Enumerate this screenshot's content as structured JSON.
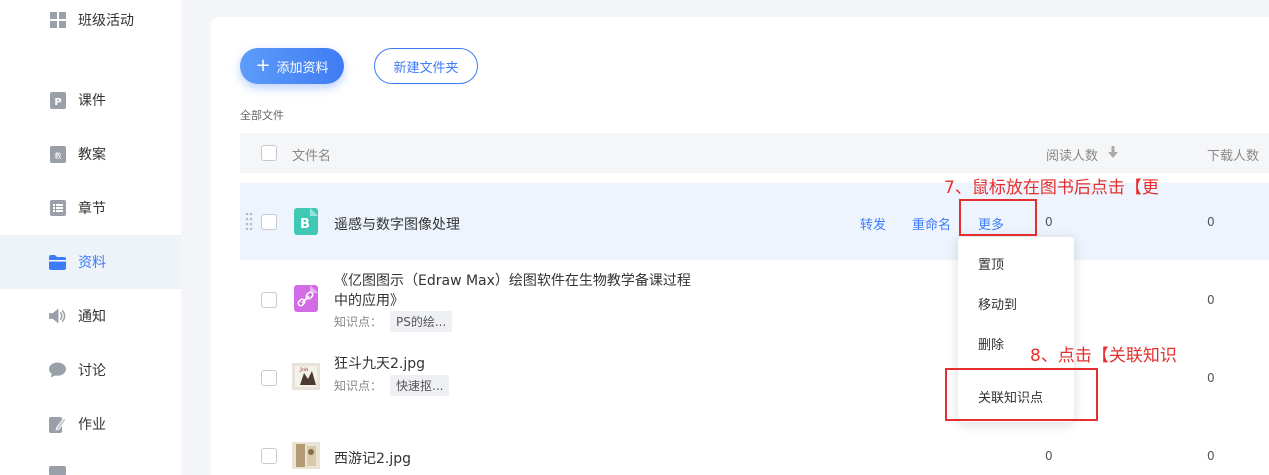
{
  "sidebar": {
    "items": [
      {
        "label": "班级活动",
        "icon": "grid-icon"
      },
      {
        "label": "课件",
        "icon": "courseware-icon"
      },
      {
        "label": "教案",
        "icon": "lesson-plan-icon"
      },
      {
        "label": "章节",
        "icon": "chapter-list-icon"
      },
      {
        "label": "资料",
        "icon": "folder-icon"
      },
      {
        "label": "通知",
        "icon": "speaker-icon"
      },
      {
        "label": "讨论",
        "icon": "chat-bubble-icon"
      },
      {
        "label": "作业",
        "icon": "homework-edit-icon"
      }
    ]
  },
  "toolbar": {
    "add_label": "添加资料",
    "new_folder_label": "新建文件夹"
  },
  "breadcrumb": "全部文件",
  "table": {
    "headers": {
      "name": "文件名",
      "reads": "阅读人数",
      "downloads": "下载人数"
    },
    "rows": [
      {
        "name": "遥感与数字图像处理",
        "reads": "0",
        "downloads": "0",
        "icon": "book-b-icon",
        "actions": {
          "forward": "转发",
          "rename": "重命名",
          "more": "更多"
        }
      },
      {
        "name_line1": "《亿图图示（Edraw Max）绘图软件在生物教学备课过程",
        "name_line2": "中的应用》",
        "kp_label": "知识点：",
        "kp_tag": "PS的绘...",
        "downloads": "0",
        "icon": "link-file-icon"
      },
      {
        "name": "狂斗九天2.jpg",
        "kp_label": "知识点：",
        "kp_tag": "快速抠...",
        "downloads": "0",
        "icon": "image-thumbnail-icon"
      },
      {
        "name": "西游记2.jpg",
        "reads": "0",
        "downloads": "0",
        "icon": "image-thumbnail-icon"
      }
    ]
  },
  "more_menu": {
    "items": [
      "置顶",
      "移动到",
      "删除",
      "关联知识点"
    ]
  },
  "annotations": {
    "step7": "7、鼠标放在图书后点击【更",
    "step8": "8、点击【关联知识"
  },
  "colors": {
    "accent": "#3d7bf7",
    "annotation_red": "#e62e2e"
  }
}
